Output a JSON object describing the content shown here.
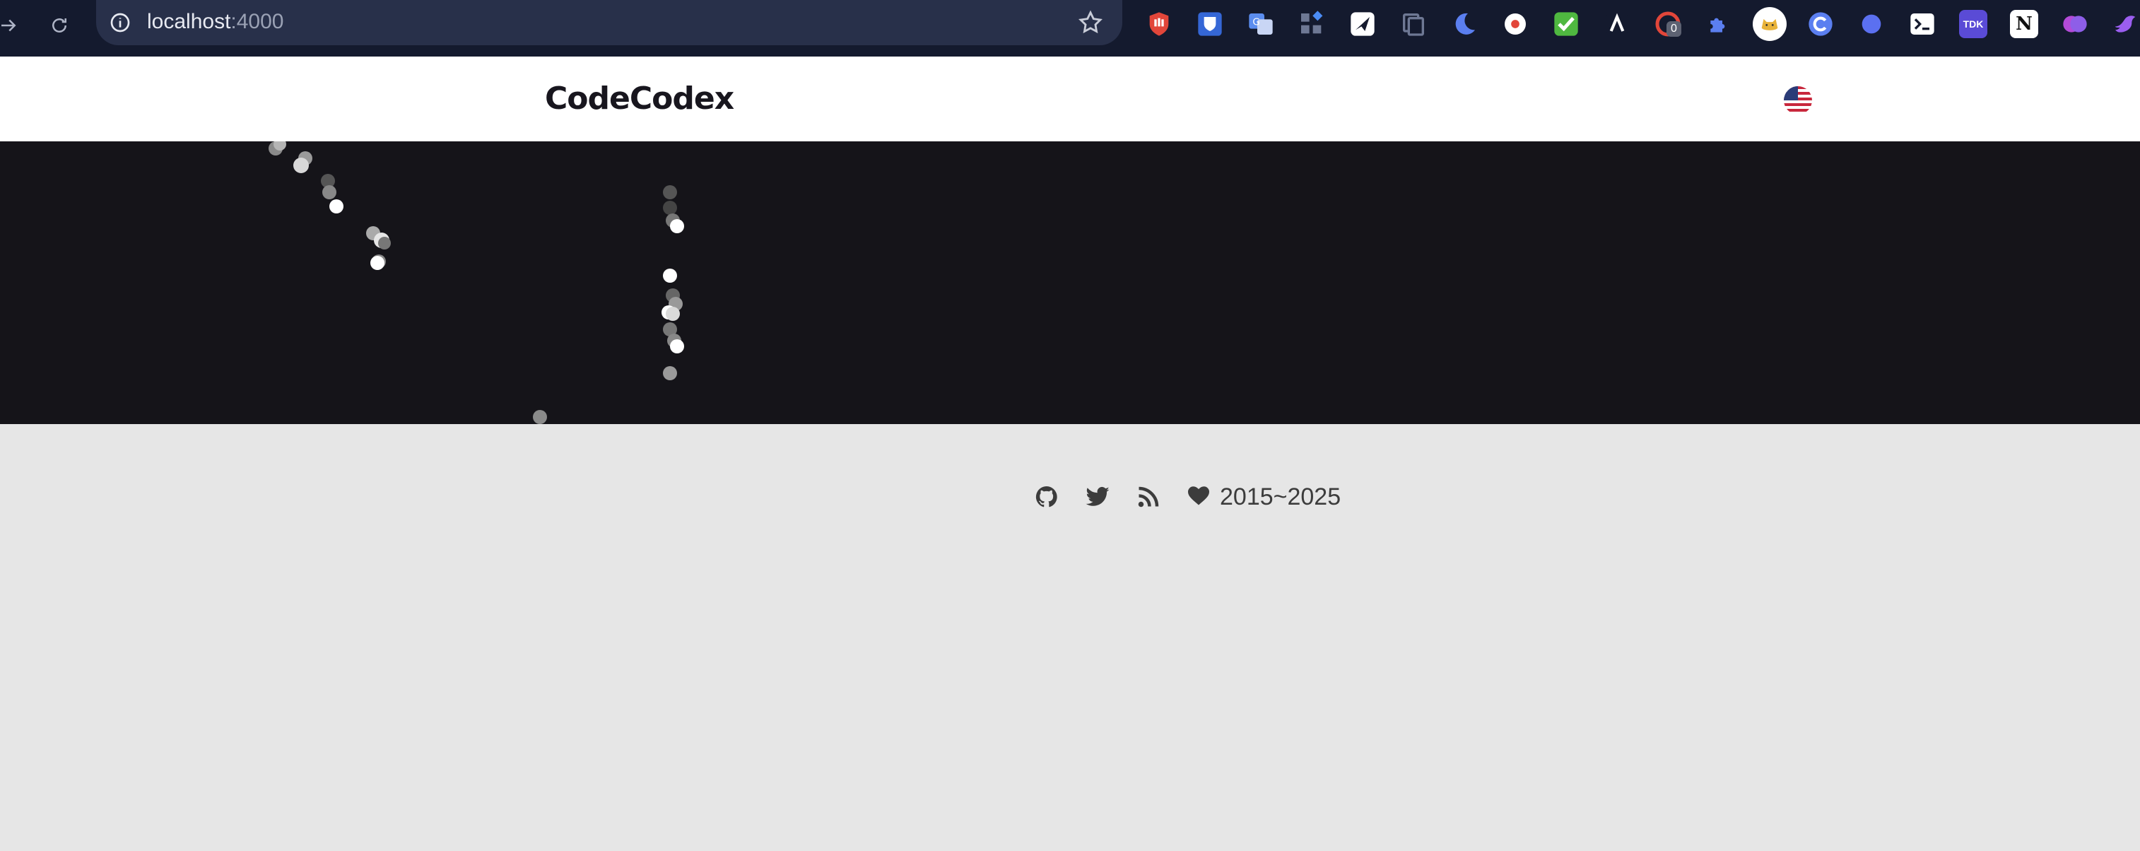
{
  "browser": {
    "url_host": "localhost",
    "url_port": ":4000",
    "extensions": [
      "adblock-icon",
      "bitwarden-icon",
      "translate-icon",
      "apps-icon",
      "send-icon",
      "copy-icon",
      "dark-mode-icon",
      "record-icon",
      "checkmark-icon",
      "arc-icon",
      "counter-icon",
      "puzzle-icon",
      "cat-icon",
      "refresh-circle-icon",
      "blue-dot-icon",
      "terminal-icon",
      "tdk-icon",
      "notion-icon",
      "brain-icon",
      "bird-icon"
    ],
    "counter_badge": "0",
    "tdk_label": "TDK",
    "notion_label": "N"
  },
  "site": {
    "brand": "CodeCodex",
    "language": "en-US flag"
  },
  "hero": {
    "background": "#151419"
  },
  "footer": {
    "copyright_years": "2015~2025",
    "links": [
      "github-icon",
      "twitter-icon",
      "rss-icon"
    ]
  },
  "colors": {
    "chrome_bg": "#141a2e",
    "urlbar_bg": "#28304a",
    "page_bg": "#e6e6e6",
    "footer_text": "#3c3c3c"
  }
}
